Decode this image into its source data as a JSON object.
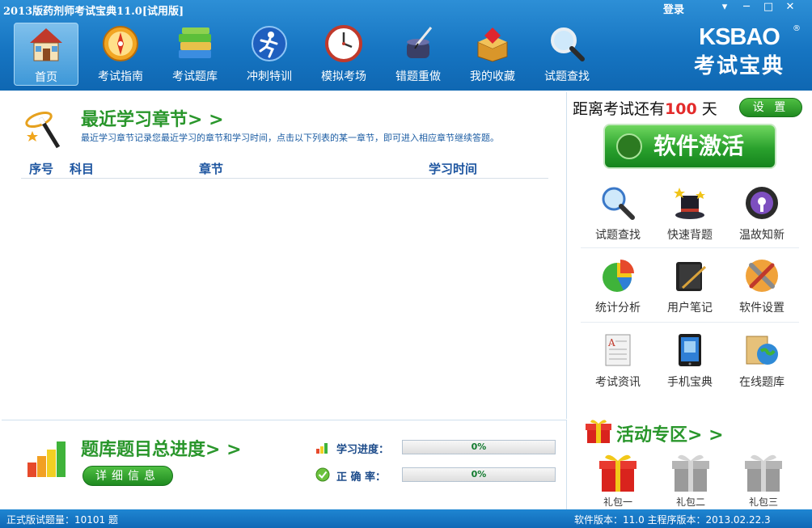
{
  "app": {
    "title": "2013版药剂师考试宝典11.0[试用版]",
    "login": "登录",
    "window_buttons": {
      "menu": "▾",
      "minimize": "─",
      "maximize": "□",
      "close": "✕"
    }
  },
  "toolbar": [
    {
      "label": "首页",
      "icon": "home-icon"
    },
    {
      "label": "考试指南",
      "icon": "compass-icon"
    },
    {
      "label": "考试题库",
      "icon": "books-icon"
    },
    {
      "label": "冲刺特训",
      "icon": "runner-icon"
    },
    {
      "label": "模拟考场",
      "icon": "clock-icon"
    },
    {
      "label": "错题重做",
      "icon": "ink-pen-icon"
    },
    {
      "label": "我的收藏",
      "icon": "treasure-box-icon"
    },
    {
      "label": "试题查找",
      "icon": "magnifier-icon"
    }
  ],
  "brand": {
    "logo_text": "KSBAO",
    "registered": "®",
    "tagline": "考试宝典"
  },
  "recent": {
    "title": "最近学习章节> >",
    "description": "最近学习章节记录您最近学习的章节和学习时间，点击以下列表的某一章节，即可进入相应章节继续答题。",
    "columns": {
      "index": "序号",
      "subject": "科目",
      "chapter": "章节",
      "time": "学习时间"
    },
    "rows": []
  },
  "progress": {
    "title": "题库题目总进度> >",
    "detail_button": "详细信息",
    "study_label": "学习进度：",
    "study_value": "0%",
    "accuracy_label": "正 确 率：",
    "accuracy_value": "0%",
    "study_fraction": 0,
    "accuracy_fraction": 0
  },
  "right": {
    "countdown_prefix": "距离考试还有",
    "countdown_days": "100",
    "countdown_suffix": "天",
    "settings_button": "设 置",
    "activate_button": "软件激活",
    "functions": [
      {
        "label": "试题查找",
        "icon": "magnifier-icon"
      },
      {
        "label": "快速背题",
        "icon": "magic-hat-icon"
      },
      {
        "label": "温故知新",
        "icon": "ipod-icon"
      },
      {
        "label": "统计分析",
        "icon": "pie-chart-icon"
      },
      {
        "label": "用户笔记",
        "icon": "notebook-icon"
      },
      {
        "label": "软件设置",
        "icon": "tools-icon"
      },
      {
        "label": "考试资讯",
        "icon": "document-icon"
      },
      {
        "label": "手机宝典",
        "icon": "tablet-icon"
      },
      {
        "label": "在线题库",
        "icon": "globe-folder-icon"
      }
    ],
    "activity_title": "活动专区> >",
    "gifts": [
      {
        "label": "礼包一",
        "color": "#d9231d"
      },
      {
        "label": "礼包二",
        "color": "#9a9a9a"
      },
      {
        "label": "礼包三",
        "color": "#9a9a9a"
      }
    ]
  },
  "status": {
    "left": "正式版试题量：10101 题",
    "right": "软件版本：11.0 主程序版本：2013.02.22.3"
  },
  "colors": {
    "toolbar_blue": "#1675c2",
    "accent_green": "#29962b",
    "days_red": "#e32b2b"
  }
}
